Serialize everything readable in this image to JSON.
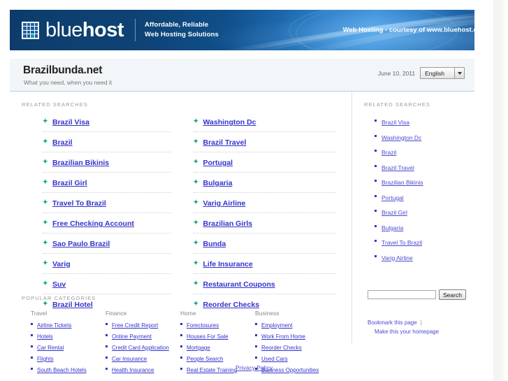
{
  "banner": {
    "logo_text_light": "blue",
    "logo_text_bold": "host",
    "tagline_line1": "Affordable, Reliable",
    "tagline_line2": "Web Hosting Solutions",
    "courtesy": "Web Hosting - courtesy of www.bluehost.com",
    "accent_color": "#14a3a0",
    "background_color": "#0d3c6b"
  },
  "title_bar": {
    "domain": "Brazilbunda.net",
    "subtitle": "What you need, when you need it",
    "date": "June 10, 2011",
    "language": "English"
  },
  "main": {
    "related_label": "RELATED SEARCHES",
    "related_left": [
      "Brazil Visa",
      "Brazil",
      "Brazilian Bikinis",
      "Brazil Girl",
      "Travel To Brazil",
      "Free Checking Account",
      "Sao Paulo Brazil",
      "Varig",
      "Suv",
      "Brazil Hotel"
    ],
    "related_right": [
      "Washington Dc",
      "Brazil Travel",
      "Portugal",
      "Bulgaria",
      "Varig Airline",
      "Brazilian Girls",
      "Bunda",
      "Life Insurance",
      "Restaurant Coupons",
      "Reorder Checks"
    ],
    "popular_label": "POPULAR CATEGORIES",
    "categories": [
      {
        "heading": "Travel",
        "links": [
          "Airline Tickets",
          "Hotels",
          "Car Rental",
          "Flights",
          "South Beach Hotels"
        ]
      },
      {
        "heading": "Finance",
        "links": [
          "Free Credit Report",
          "Online Payment",
          "Credit Card Application",
          "Car Insurance",
          "Health Insurance"
        ]
      },
      {
        "heading": "Home",
        "links": [
          "Foreclosures",
          "Houses For Sale",
          "Mortgage",
          "People Search",
          "Real Estate Training"
        ]
      },
      {
        "heading": "Business",
        "links": [
          "Employment",
          "Work From Home",
          "Reorder Checks",
          "Used Cars",
          "Business Opportunities"
        ]
      }
    ]
  },
  "sidebar": {
    "related_label": "RELATED SEARCHES",
    "links": [
      "Brazil Visa",
      "Washington Dc",
      "Brazil",
      "Brazil Travel",
      "Brazilian Bikinis",
      "Portugal",
      "Brazil Girl",
      "Bulgaria",
      "Travel To Brazil",
      "Varig Airline"
    ],
    "search_value": "",
    "search_placeholder": "",
    "search_button": "Search",
    "bookmark_link": "Bookmark this page",
    "separator": "|",
    "homepage_link": "Make this your homepage"
  },
  "footer": {
    "privacy": "Privacy Policy"
  },
  "icons": {
    "bullet_star": "✦",
    "dropdown_arrow": "chevron-down-icon"
  }
}
